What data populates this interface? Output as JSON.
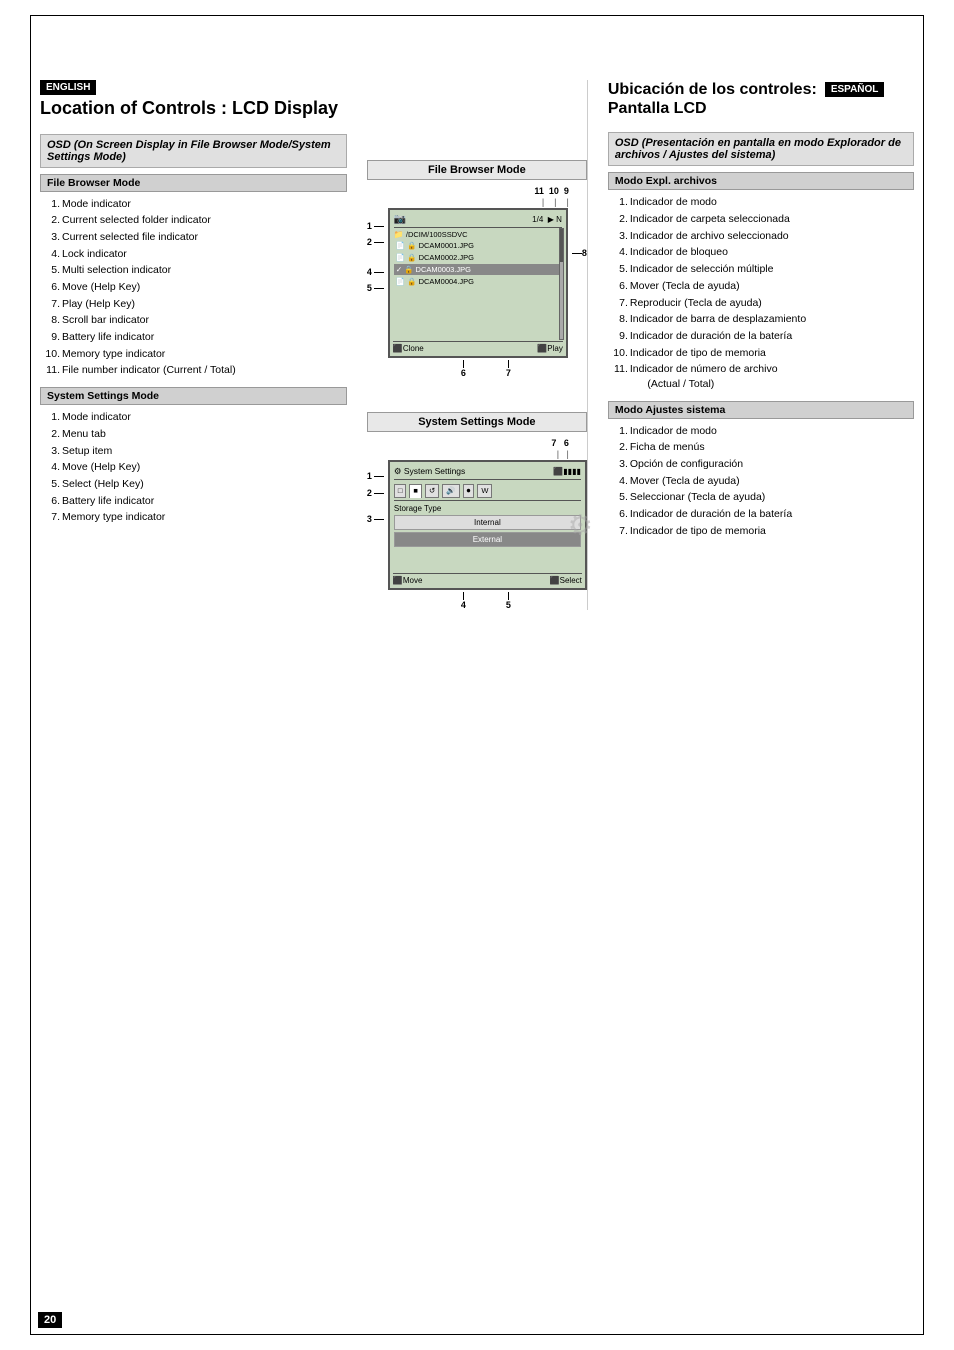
{
  "page": {
    "number": "20"
  },
  "english": {
    "lang_badge": "ENGLISH",
    "title": "Location of Controls : LCD Display",
    "osd_header": "OSD (On Screen Display in File Browser Mode/System Settings Mode)",
    "file_browser_mode": {
      "label": "File Browser Mode",
      "items": [
        {
          "num": "1.",
          "text": "Mode indicator"
        },
        {
          "num": "2.",
          "text": "Current selected folder indicator"
        },
        {
          "num": "3.",
          "text": "Current selected file indicator"
        },
        {
          "num": "4.",
          "text": "Lock indicator"
        },
        {
          "num": "5.",
          "text": "Multi selection indicator"
        },
        {
          "num": "6.",
          "text": "Move (Help Key)"
        },
        {
          "num": "7.",
          "text": "Play (Help Key)"
        },
        {
          "num": "8.",
          "text": "Scroll bar indicator"
        },
        {
          "num": "9.",
          "text": "Battery life indicator"
        },
        {
          "num": "10.",
          "text": "Memory type indicator"
        },
        {
          "num": "11.",
          "text": "File number indicator (Current / Total)"
        }
      ]
    },
    "system_settings_mode": {
      "label": "System Settings Mode",
      "items": [
        {
          "num": "1.",
          "text": "Mode indicator"
        },
        {
          "num": "2.",
          "text": "Menu tab"
        },
        {
          "num": "3.",
          "text": "Setup item"
        },
        {
          "num": "4.",
          "text": "Move (Help Key)"
        },
        {
          "num": "5.",
          "text": "Select (Help Key)"
        },
        {
          "num": "6.",
          "text": "Battery life indicator"
        },
        {
          "num": "7.",
          "text": "Memory type indicator"
        }
      ]
    }
  },
  "spanish": {
    "lang_badge": "ESPAÑOL",
    "title_line1": "Ubicación de los controles:",
    "title_line2": "Pantalla LCD",
    "osd_header": "OSD (Presentación en pantalla en modo Explorador de archivos / Ajustes del sistema)",
    "file_browser_mode": {
      "label": "Modo Expl. archivos",
      "items": [
        {
          "num": "1.",
          "text": "Indicador de modo"
        },
        {
          "num": "2.",
          "text": "Indicador de carpeta seleccionada"
        },
        {
          "num": "3.",
          "text": "Indicador de archivo seleccionado"
        },
        {
          "num": "4.",
          "text": "Indicador de bloqueo"
        },
        {
          "num": "5.",
          "text": "Indicador de selección múltiple"
        },
        {
          "num": "6.",
          "text": "Mover (Tecla de ayuda)"
        },
        {
          "num": "7.",
          "text": "Reproducir (Tecla de ayuda)"
        },
        {
          "num": "8.",
          "text": "Indicador de barra de desplazamiento"
        },
        {
          "num": "9.",
          "text": "Indicador de duración de la batería"
        },
        {
          "num": "10.",
          "text": "Indicador de tipo de memoria"
        },
        {
          "num": "11.",
          "text": "Indicador de número de archivo (Actual / Total)"
        }
      ]
    },
    "system_settings_mode": {
      "label": "Modo Ajustes sistema",
      "items": [
        {
          "num": "1.",
          "text": "Indicador de modo"
        },
        {
          "num": "2.",
          "text": "Ficha de menús"
        },
        {
          "num": "3.",
          "text": "Opción de configuración"
        },
        {
          "num": "4.",
          "text": "Mover (Tecla de ayuda)"
        },
        {
          "num": "5.",
          "text": "Seleccionar (Tecla de ayuda)"
        },
        {
          "num": "6.",
          "text": "Indicador de duración de la batería"
        },
        {
          "num": "7.",
          "text": "Indicador de tipo de memoria"
        }
      ]
    }
  },
  "screens": {
    "file_browser": {
      "title": "File Browser Mode",
      "top_nums": "11  10  9",
      "path": "/DCIM/100SSDVC",
      "files": [
        {
          "name": "DCAM0001.JPG",
          "icon": "📄",
          "locked": false,
          "checked": false
        },
        {
          "name": "DCAM0002.JPG",
          "icon": "📄",
          "locked": false,
          "checked": false
        },
        {
          "name": "DCAM0003.JPG",
          "icon": "📄",
          "locked": false,
          "checked": true,
          "selected": true
        },
        {
          "name": "DCAM0004.JPG",
          "icon": "📄",
          "locked": false,
          "checked": false
        }
      ],
      "bottom_left": "⬛Clone",
      "bottom_right": "⬛Play",
      "left_nums": [
        "1",
        "2",
        "4",
        "5"
      ],
      "right_num": "8",
      "bottom_nums": [
        "6",
        "7"
      ]
    },
    "system_settings": {
      "title": "System Settings Mode",
      "top_nums": "7  6",
      "title_bar": "⚙ System Settings",
      "tabs": [
        "□",
        "■",
        "⟲",
        "🔊",
        "⏺",
        "▶"
      ],
      "setting_label": "Storage Type",
      "options": [
        "Internal",
        "External"
      ],
      "bottom_left": "⬛Move",
      "bottom_right": "⬛Select",
      "left_nums": [
        "1",
        "2",
        "3"
      ],
      "bottom_nums": [
        "4",
        "5"
      ]
    }
  }
}
